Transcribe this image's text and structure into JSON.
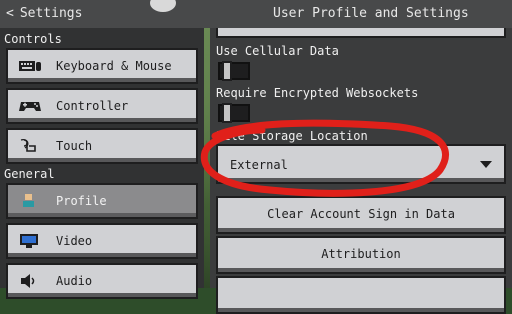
{
  "header": {
    "back_label": "Settings",
    "title": "User Profile and Settings"
  },
  "sidebar": {
    "sections": [
      {
        "title": "Controls"
      },
      {
        "title": "General"
      }
    ],
    "items": [
      {
        "label": "Keyboard & Mouse",
        "icon": "keyboard-icon"
      },
      {
        "label": "Controller",
        "icon": "gamepad-icon"
      },
      {
        "label": "Touch",
        "icon": "touch-hand-icon"
      },
      {
        "label": "Profile",
        "icon": "profile-icon",
        "active": true
      },
      {
        "label": "Video",
        "icon": "monitor-icon"
      },
      {
        "label": "Audio",
        "icon": "speaker-icon"
      }
    ]
  },
  "settings": {
    "cellular": {
      "label": "Use Cellular Data",
      "enabled": false
    },
    "websockets": {
      "label": "Require Encrypted Websockets",
      "enabled": false
    },
    "storage": {
      "label": "File Storage Location",
      "value": "External"
    },
    "clear_button": "Clear Account Sign in Data",
    "attribution_button": "Attribution"
  },
  "colors": {
    "annotation_red": "#e0201a",
    "button_face": "#d0d1d4",
    "active_tab": "#8b8b8d"
  }
}
